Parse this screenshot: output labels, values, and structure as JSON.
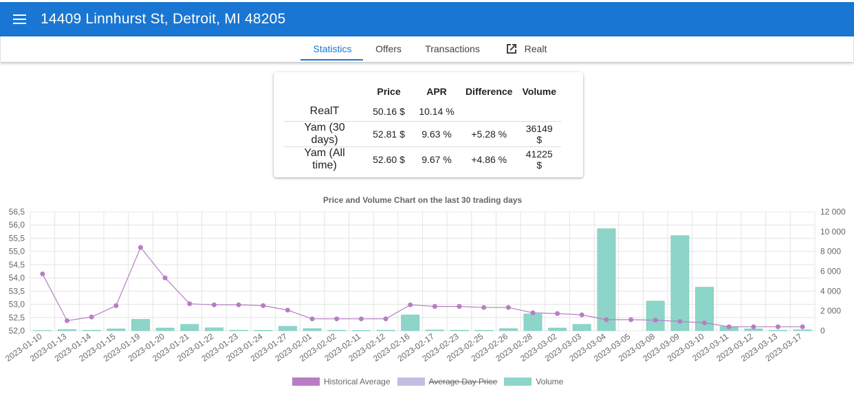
{
  "header": {
    "title": "14409 Linnhurst St, Detroit, MI 48205",
    "menu_icon": "hamburger-menu-icon"
  },
  "tabs": [
    {
      "label": "Statistics",
      "active": true
    },
    {
      "label": "Offers",
      "active": false
    },
    {
      "label": "Transactions",
      "active": false
    },
    {
      "label": "Realt",
      "active": false,
      "icon": "open-in-new-icon"
    }
  ],
  "stats": {
    "headers": [
      "Price",
      "APR",
      "Difference",
      "Volume"
    ],
    "rows": [
      {
        "label": "RealT",
        "price": "50.16 $",
        "apr": "10.14 %",
        "difference": "",
        "volume": ""
      },
      {
        "label": "Yam (30 days)",
        "price": "52.81 $",
        "apr": "9.63 %",
        "difference": "+5.28 %",
        "volume": "36149 $"
      },
      {
        "label": "Yam (All time)",
        "price": "52.60 $",
        "apr": "9.67 %",
        "difference": "+4.86 %",
        "volume": "41225 $"
      }
    ]
  },
  "colors": {
    "appbar": "#1976d2",
    "historical": "#b87dc4",
    "average_day": "#c5bde0",
    "volume": "#8dd5c8"
  },
  "chart_data": {
    "type": "bar",
    "title": "Price and Volume Chart on the last 30 trading days",
    "categories": [
      "2023-01-10",
      "2023-01-13",
      "2023-01-14",
      "2023-01-15",
      "2023-01-19",
      "2023-01-20",
      "2023-01-21",
      "2023-01-22",
      "2023-01-23",
      "2023-01-24",
      "2023-01-27",
      "2023-02-01",
      "2023-02-02",
      "2023-02-11",
      "2023-02-12",
      "2023-02-16",
      "2023-02-17",
      "2023-02-23",
      "2023-02-25",
      "2023-02-26",
      "2023-02-28",
      "2023-03-02",
      "2023-03-03",
      "2023-03-04",
      "2023-03-05",
      "2023-03-08",
      "2023-03-09",
      "2023-03-10",
      "2023-03-11",
      "2023-03-12",
      "2023-03-13",
      "2023-03-17"
    ],
    "series": [
      {
        "name": "Historical Average",
        "axis": "left",
        "kind": "line",
        "values": [
          54.15,
          52.38,
          52.52,
          52.95,
          55.15,
          54.0,
          53.02,
          52.98,
          52.98,
          52.95,
          52.78,
          52.45,
          52.45,
          52.45,
          52.45,
          52.98,
          52.92,
          52.92,
          52.88,
          52.88,
          52.68,
          52.65,
          52.6,
          52.42,
          52.42,
          52.4,
          52.35,
          52.3,
          52.15,
          52.15,
          52.15,
          52.15
        ]
      },
      {
        "name": "Average Day Price",
        "axis": "left",
        "kind": "line",
        "hidden": true,
        "values": []
      },
      {
        "name": "Volume",
        "axis": "right",
        "kind": "bar",
        "values": [
          30,
          120,
          60,
          200,
          1150,
          280,
          650,
          300,
          60,
          50,
          450,
          220,
          60,
          40,
          60,
          1600,
          80,
          60,
          50,
          220,
          1700,
          280,
          650,
          10300,
          0,
          3000,
          9600,
          4400,
          420,
          200,
          60,
          100
        ]
      }
    ],
    "y_left": {
      "min": 52.0,
      "max": 56.5,
      "ticks": [
        "52,0",
        "52,5",
        "53,0",
        "53,5",
        "54,0",
        "54,5",
        "55,0",
        "55,5",
        "56,0",
        "56,5"
      ]
    },
    "y_right": {
      "min": 0,
      "max": 12000,
      "ticks": [
        "0",
        "2 000",
        "4 000",
        "6 000",
        "8 000",
        "10 000",
        "12 000"
      ]
    },
    "grid": true,
    "legend_position": "bottom"
  }
}
